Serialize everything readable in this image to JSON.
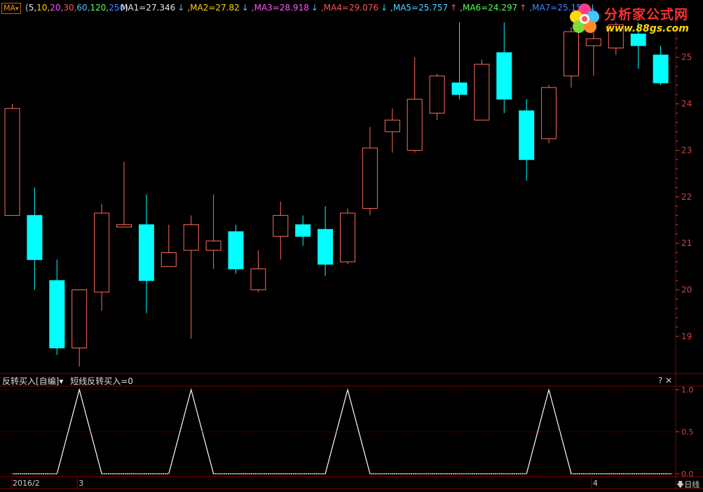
{
  "header": {
    "ma_button": "MA",
    "params_open": "(",
    "params": [
      {
        "text": "5,",
        "color": "#e6e6e6"
      },
      {
        "text": "10,",
        "color": "#ffd700"
      },
      {
        "text": "20,",
        "color": "#ff55ff"
      },
      {
        "text": "30,",
        "color": "#ff5555"
      },
      {
        "text": "60,",
        "color": "#4fc3f7"
      },
      {
        "text": "120,",
        "color": "#55ff55"
      },
      {
        "text": "250",
        "color": "#4488ff"
      }
    ],
    "params_close": ")",
    "mas": [
      {
        "label": "MA1=27.346",
        "arrow": "↓",
        "color": "#e6e6e6",
        "arrow_color": "#40c0ff"
      },
      {
        "label": ",MA2=27.82",
        "arrow": "↓",
        "color": "#ffd700",
        "arrow_color": "#40c0ff"
      },
      {
        "label": ",MA3=28.918",
        "arrow": "↓",
        "color": "#ff55ff",
        "arrow_color": "#40c0ff"
      },
      {
        "label": ",MA4=29.076",
        "arrow": "↓",
        "color": "#ff5555",
        "arrow_color": "#40c0ff"
      },
      {
        "label": ",MA5=25.757",
        "arrow": "↑",
        "color": "#4fd8ff",
        "arrow_color": "#ff5555"
      },
      {
        "label": ",MA6=24.297",
        "arrow": "↑",
        "color": "#55ff55",
        "arrow_color": "#ff5555"
      },
      {
        "label": ",MA7=25.154",
        "arrow": "↓",
        "color": "#4488ff",
        "arrow_color": "#40c0ff"
      }
    ]
  },
  "logo": {
    "name": "分析家公式网",
    "url": "www.88gs.com"
  },
  "indicator_header": {
    "title": "反转买入[自编]▾",
    "formula": "短线反转买入=0"
  },
  "indicator_buttons": "? ✕",
  "period_label": "日线",
  "colors": {
    "up": "#ff6a5a",
    "down": "#00ffff",
    "grid": "#8b0000",
    "axis_text": "#cc4444",
    "signal": "#ffffff"
  },
  "chart_data": {
    "type": "candlestick",
    "price_axis": {
      "ylim": [
        18.2,
        25.9
      ],
      "ticks": [
        19,
        20,
        21,
        22,
        23,
        24,
        25
      ]
    },
    "candles": [
      {
        "o": 21.6,
        "c": 23.9,
        "h": 24.0,
        "l": 21.6
      },
      {
        "o": 21.6,
        "c": 20.65,
        "h": 22.2,
        "l": 20.0
      },
      {
        "o": 20.2,
        "c": 18.75,
        "h": 20.65,
        "l": 18.6
      },
      {
        "o": 18.75,
        "c": 20.0,
        "h": 20.0,
        "l": 18.35
      },
      {
        "o": 19.95,
        "c": 21.65,
        "h": 21.85,
        "l": 19.55
      },
      {
        "o": 21.35,
        "c": 21.4,
        "h": 22.75,
        "l": 21.35
      },
      {
        "o": 21.4,
        "c": 20.2,
        "h": 22.05,
        "l": 19.5
      },
      {
        "o": 20.5,
        "c": 20.8,
        "h": 21.4,
        "l": 20.5
      },
      {
        "o": 20.85,
        "c": 21.4,
        "h": 21.6,
        "l": 18.95
      },
      {
        "o": 20.85,
        "c": 21.05,
        "h": 22.05,
        "l": 20.45
      },
      {
        "o": 21.25,
        "c": 20.45,
        "h": 21.4,
        "l": 20.35
      },
      {
        "o": 20.0,
        "c": 20.45,
        "h": 20.85,
        "l": 19.95
      },
      {
        "o": 21.15,
        "c": 21.6,
        "h": 21.9,
        "l": 20.65
      },
      {
        "o": 21.4,
        "c": 21.15,
        "h": 21.6,
        "l": 20.95
      },
      {
        "o": 21.3,
        "c": 20.55,
        "h": 21.8,
        "l": 20.3
      },
      {
        "o": 20.6,
        "c": 21.65,
        "h": 21.75,
        "l": 20.55
      },
      {
        "o": 21.75,
        "c": 23.05,
        "h": 23.5,
        "l": 21.6
      },
      {
        "o": 23.4,
        "c": 23.65,
        "h": 23.9,
        "l": 22.95
      },
      {
        "o": 23.0,
        "c": 24.1,
        "h": 25.0,
        "l": 22.95
      },
      {
        "o": 23.8,
        "c": 24.6,
        "h": 24.65,
        "l": 23.65
      },
      {
        "o": 24.45,
        "c": 24.2,
        "h": 25.75,
        "l": 24.1
      },
      {
        "o": 23.65,
        "c": 24.85,
        "h": 24.95,
        "l": 23.65
      },
      {
        "o": 25.1,
        "c": 24.1,
        "h": 25.75,
        "l": 23.8
      },
      {
        "o": 23.85,
        "c": 22.8,
        "h": 24.1,
        "l": 22.35
      },
      {
        "o": 23.25,
        "c": 24.35,
        "h": 24.4,
        "l": 23.15
      },
      {
        "o": 24.6,
        "c": 25.55,
        "h": 25.65,
        "l": 24.35
      },
      {
        "o": 25.25,
        "c": 25.4,
        "h": 25.75,
        "l": 24.6
      },
      {
        "o": 25.2,
        "c": 25.7,
        "h": 25.75,
        "l": 25.05
      },
      {
        "o": 25.5,
        "c": 25.25,
        "h": 25.75,
        "l": 24.75
      },
      {
        "o": 25.05,
        "c": 24.45,
        "h": 25.25,
        "l": 24.4
      }
    ],
    "indicator": {
      "name": "短线反转买入",
      "ylim": [
        0,
        1.0
      ],
      "ticks": [
        0.0,
        0.5,
        1.0
      ],
      "tick_labels": [
        "0.0",
        "0.5",
        "1.0"
      ],
      "values": [
        0,
        0,
        0,
        1,
        0,
        0,
        0,
        0,
        1,
        0,
        0,
        0,
        0,
        0,
        0,
        1,
        0,
        0,
        0,
        0,
        0,
        0,
        0,
        0,
        1,
        0,
        0,
        0,
        0,
        0
      ]
    },
    "dates": [
      {
        "label": "2016/2",
        "index": 0
      },
      {
        "label": "3",
        "index": 3
      },
      {
        "label": "4",
        "index": 26
      }
    ]
  }
}
